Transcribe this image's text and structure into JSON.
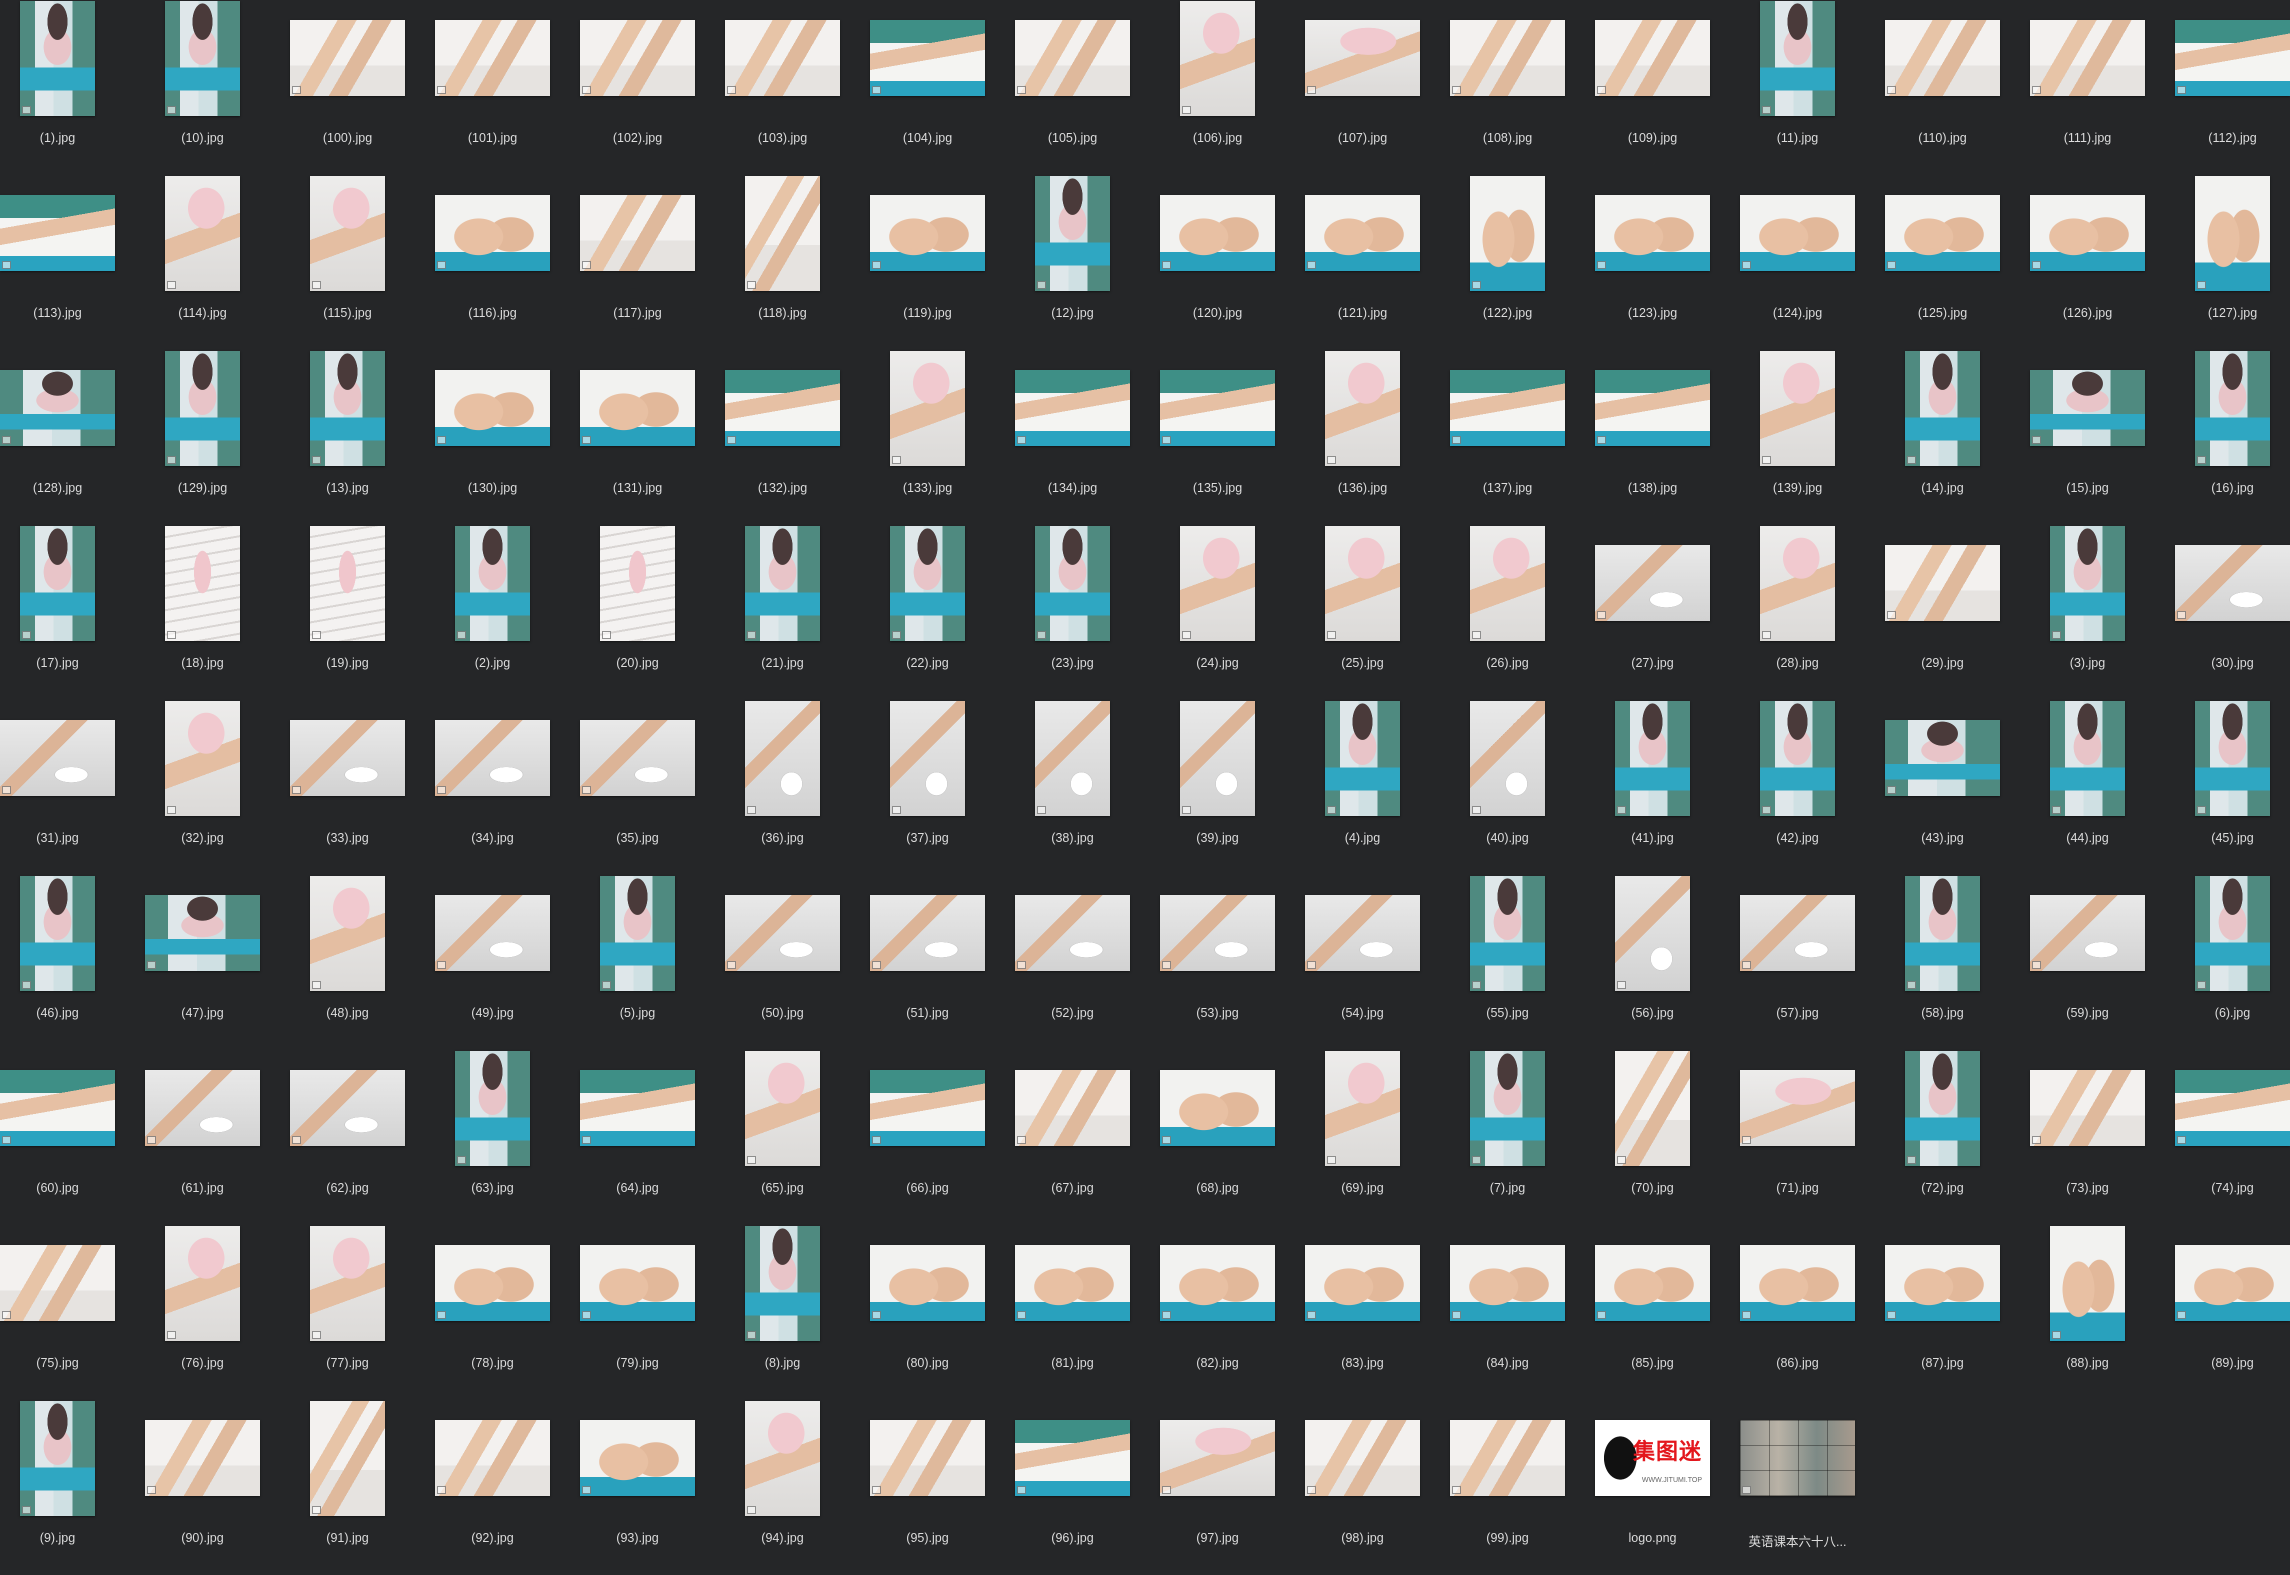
{
  "files": [
    {
      "name": "(1).jpg",
      "kind": "portrait",
      "style": "room"
    },
    {
      "name": "(10).jpg",
      "kind": "portrait",
      "style": "room"
    },
    {
      "name": "(100).jpg",
      "kind": "landscape",
      "style": "legs"
    },
    {
      "name": "(101).jpg",
      "kind": "landscape",
      "style": "legs"
    },
    {
      "name": "(102).jpg",
      "kind": "landscape",
      "style": "legs"
    },
    {
      "name": "(103).jpg",
      "kind": "landscape",
      "style": "legs"
    },
    {
      "name": "(104).jpg",
      "kind": "landscape",
      "style": "sofa"
    },
    {
      "name": "(105).jpg",
      "kind": "landscape",
      "style": "legs"
    },
    {
      "name": "(106).jpg",
      "kind": "portrait",
      "style": "pink"
    },
    {
      "name": "(107).jpg",
      "kind": "landscape",
      "style": "pink"
    },
    {
      "name": "(108).jpg",
      "kind": "landscape",
      "style": "legs"
    },
    {
      "name": "(109).jpg",
      "kind": "landscape",
      "style": "legs"
    },
    {
      "name": "(11).jpg",
      "kind": "portrait",
      "style": "room"
    },
    {
      "name": "(110).jpg",
      "kind": "landscape",
      "style": "legs"
    },
    {
      "name": "(111).jpg",
      "kind": "landscape",
      "style": "legs"
    },
    {
      "name": "(112).jpg",
      "kind": "landscape",
      "style": "sofa"
    },
    {
      "name": "(113).jpg",
      "kind": "landscape",
      "style": "sofa"
    },
    {
      "name": "(114).jpg",
      "kind": "portrait",
      "style": "pink"
    },
    {
      "name": "(115).jpg",
      "kind": "portrait",
      "style": "pink"
    },
    {
      "name": "(116).jpg",
      "kind": "landscape",
      "style": "feet"
    },
    {
      "name": "(117).jpg",
      "kind": "landscape",
      "style": "legs"
    },
    {
      "name": "(118).jpg",
      "kind": "portrait",
      "style": "legs"
    },
    {
      "name": "(119).jpg",
      "kind": "landscape",
      "style": "feet"
    },
    {
      "name": "(12).jpg",
      "kind": "portrait",
      "style": "room"
    },
    {
      "name": "(120).jpg",
      "kind": "landscape",
      "style": "feet"
    },
    {
      "name": "(121).jpg",
      "kind": "landscape",
      "style": "feet"
    },
    {
      "name": "(122).jpg",
      "kind": "portrait",
      "style": "feet"
    },
    {
      "name": "(123).jpg",
      "kind": "landscape",
      "style": "feet"
    },
    {
      "name": "(124).jpg",
      "kind": "landscape",
      "style": "feet"
    },
    {
      "name": "(125).jpg",
      "kind": "landscape",
      "style": "feet"
    },
    {
      "name": "(126).jpg",
      "kind": "landscape",
      "style": "feet"
    },
    {
      "name": "(127).jpg",
      "kind": "portrait",
      "style": "feet"
    },
    {
      "name": "(128).jpg",
      "kind": "landscape",
      "style": "room"
    },
    {
      "name": "(129).jpg",
      "kind": "portrait",
      "style": "room"
    },
    {
      "name": "(13).jpg",
      "kind": "portrait",
      "style": "room"
    },
    {
      "name": "(130).jpg",
      "kind": "landscape",
      "style": "feet"
    },
    {
      "name": "(131).jpg",
      "kind": "landscape",
      "style": "feet"
    },
    {
      "name": "(132).jpg",
      "kind": "landscape",
      "style": "sofa"
    },
    {
      "name": "(133).jpg",
      "kind": "portrait",
      "style": "pink"
    },
    {
      "name": "(134).jpg",
      "kind": "landscape",
      "style": "sofa"
    },
    {
      "name": "(135).jpg",
      "kind": "landscape",
      "style": "sofa"
    },
    {
      "name": "(136).jpg",
      "kind": "portrait",
      "style": "pink"
    },
    {
      "name": "(137).jpg",
      "kind": "landscape",
      "style": "sofa"
    },
    {
      "name": "(138).jpg",
      "kind": "landscape",
      "style": "sofa"
    },
    {
      "name": "(139).jpg",
      "kind": "portrait",
      "style": "pink"
    },
    {
      "name": "(14).jpg",
      "kind": "portrait",
      "style": "room"
    },
    {
      "name": "(15).jpg",
      "kind": "landscape",
      "style": "room"
    },
    {
      "name": "(16).jpg",
      "kind": "portrait",
      "style": "room"
    },
    {
      "name": "(17).jpg",
      "kind": "portrait",
      "style": "room"
    },
    {
      "name": "(18).jpg",
      "kind": "portrait",
      "style": "stairs"
    },
    {
      "name": "(19).jpg",
      "kind": "portrait",
      "style": "stairs"
    },
    {
      "name": "(2).jpg",
      "kind": "portrait",
      "style": "room"
    },
    {
      "name": "(20).jpg",
      "kind": "portrait",
      "style": "stairs"
    },
    {
      "name": "(21).jpg",
      "kind": "portrait",
      "style": "room"
    },
    {
      "name": "(22).jpg",
      "kind": "portrait",
      "style": "room"
    },
    {
      "name": "(23).jpg",
      "kind": "portrait",
      "style": "room"
    },
    {
      "name": "(24).jpg",
      "kind": "portrait",
      "style": "pink"
    },
    {
      "name": "(25).jpg",
      "kind": "portrait",
      "style": "pink"
    },
    {
      "name": "(26).jpg",
      "kind": "portrait",
      "style": "pink"
    },
    {
      "name": "(27).jpg",
      "kind": "landscape",
      "style": "floor"
    },
    {
      "name": "(28).jpg",
      "kind": "portrait",
      "style": "pink"
    },
    {
      "name": "(29).jpg",
      "kind": "landscape",
      "style": "legs"
    },
    {
      "name": "(3).jpg",
      "kind": "portrait",
      "style": "room"
    },
    {
      "name": "(30).jpg",
      "kind": "landscape",
      "style": "floor"
    },
    {
      "name": "(31).jpg",
      "kind": "landscape",
      "style": "floor"
    },
    {
      "name": "(32).jpg",
      "kind": "portrait",
      "style": "pink"
    },
    {
      "name": "(33).jpg",
      "kind": "landscape",
      "style": "floor"
    },
    {
      "name": "(34).jpg",
      "kind": "landscape",
      "style": "floor"
    },
    {
      "name": "(35).jpg",
      "kind": "landscape",
      "style": "floor"
    },
    {
      "name": "(36).jpg",
      "kind": "portrait",
      "style": "floor"
    },
    {
      "name": "(37).jpg",
      "kind": "portrait",
      "style": "floor"
    },
    {
      "name": "(38).jpg",
      "kind": "portrait",
      "style": "floor"
    },
    {
      "name": "(39).jpg",
      "kind": "portrait",
      "style": "floor"
    },
    {
      "name": "(4).jpg",
      "kind": "portrait",
      "style": "room"
    },
    {
      "name": "(40).jpg",
      "kind": "portrait",
      "style": "floor"
    },
    {
      "name": "(41).jpg",
      "kind": "portrait",
      "style": "room"
    },
    {
      "name": "(42).jpg",
      "kind": "portrait",
      "style": "room"
    },
    {
      "name": "(43).jpg",
      "kind": "landscape",
      "style": "room"
    },
    {
      "name": "(44).jpg",
      "kind": "portrait",
      "style": "room"
    },
    {
      "name": "(45).jpg",
      "kind": "portrait",
      "style": "room"
    },
    {
      "name": "(46).jpg",
      "kind": "portrait",
      "style": "room"
    },
    {
      "name": "(47).jpg",
      "kind": "landscape",
      "style": "room"
    },
    {
      "name": "(48).jpg",
      "kind": "portrait",
      "style": "pink"
    },
    {
      "name": "(49).jpg",
      "kind": "landscape",
      "style": "floor"
    },
    {
      "name": "(5).jpg",
      "kind": "portrait",
      "style": "room"
    },
    {
      "name": "(50).jpg",
      "kind": "landscape",
      "style": "floor"
    },
    {
      "name": "(51).jpg",
      "kind": "landscape",
      "style": "floor"
    },
    {
      "name": "(52).jpg",
      "kind": "landscape",
      "style": "floor"
    },
    {
      "name": "(53).jpg",
      "kind": "landscape",
      "style": "floor"
    },
    {
      "name": "(54).jpg",
      "kind": "landscape",
      "style": "floor"
    },
    {
      "name": "(55).jpg",
      "kind": "portrait",
      "style": "room"
    },
    {
      "name": "(56).jpg",
      "kind": "portrait",
      "style": "floor"
    },
    {
      "name": "(57).jpg",
      "kind": "landscape",
      "style": "floor"
    },
    {
      "name": "(58).jpg",
      "kind": "portrait",
      "style": "room"
    },
    {
      "name": "(59).jpg",
      "kind": "landscape",
      "style": "floor"
    },
    {
      "name": "(6).jpg",
      "kind": "portrait",
      "style": "room"
    },
    {
      "name": "(60).jpg",
      "kind": "landscape",
      "style": "sofa"
    },
    {
      "name": "(61).jpg",
      "kind": "landscape",
      "style": "floor"
    },
    {
      "name": "(62).jpg",
      "kind": "landscape",
      "style": "floor"
    },
    {
      "name": "(63).jpg",
      "kind": "portrait",
      "style": "room"
    },
    {
      "name": "(64).jpg",
      "kind": "landscape",
      "style": "sofa"
    },
    {
      "name": "(65).jpg",
      "kind": "portrait",
      "style": "pink"
    },
    {
      "name": "(66).jpg",
      "kind": "landscape",
      "style": "sofa"
    },
    {
      "name": "(67).jpg",
      "kind": "landscape",
      "style": "legs"
    },
    {
      "name": "(68).jpg",
      "kind": "landscape",
      "style": "feet"
    },
    {
      "name": "(69).jpg",
      "kind": "portrait",
      "style": "pink"
    },
    {
      "name": "(7).jpg",
      "kind": "portrait",
      "style": "room"
    },
    {
      "name": "(70).jpg",
      "kind": "portrait",
      "style": "legs"
    },
    {
      "name": "(71).jpg",
      "kind": "landscape",
      "style": "pink"
    },
    {
      "name": "(72).jpg",
      "kind": "portrait",
      "style": "room"
    },
    {
      "name": "(73).jpg",
      "kind": "landscape",
      "style": "legs"
    },
    {
      "name": "(74).jpg",
      "kind": "landscape",
      "style": "sofa"
    },
    {
      "name": "(75).jpg",
      "kind": "landscape",
      "style": "legs"
    },
    {
      "name": "(76).jpg",
      "kind": "portrait",
      "style": "pink"
    },
    {
      "name": "(77).jpg",
      "kind": "portrait",
      "style": "pink"
    },
    {
      "name": "(78).jpg",
      "kind": "landscape",
      "style": "feet"
    },
    {
      "name": "(79).jpg",
      "kind": "landscape",
      "style": "feet"
    },
    {
      "name": "(8).jpg",
      "kind": "portrait",
      "style": "room"
    },
    {
      "name": "(80).jpg",
      "kind": "landscape",
      "style": "feet"
    },
    {
      "name": "(81).jpg",
      "kind": "landscape",
      "style": "feet"
    },
    {
      "name": "(82).jpg",
      "kind": "landscape",
      "style": "feet"
    },
    {
      "name": "(83).jpg",
      "kind": "landscape",
      "style": "feet"
    },
    {
      "name": "(84).jpg",
      "kind": "landscape",
      "style": "feet"
    },
    {
      "name": "(85).jpg",
      "kind": "landscape",
      "style": "feet"
    },
    {
      "name": "(86).jpg",
      "kind": "landscape",
      "style": "feet"
    },
    {
      "name": "(87).jpg",
      "kind": "landscape",
      "style": "feet"
    },
    {
      "name": "(88).jpg",
      "kind": "portrait",
      "style": "feet"
    },
    {
      "name": "(89).jpg",
      "kind": "landscape",
      "style": "feet"
    },
    {
      "name": "(9).jpg",
      "kind": "portrait",
      "style": "room"
    },
    {
      "name": "(90).jpg",
      "kind": "landscape",
      "style": "legs"
    },
    {
      "name": "(91).jpg",
      "kind": "portrait",
      "style": "legs"
    },
    {
      "name": "(92).jpg",
      "kind": "landscape",
      "style": "legs"
    },
    {
      "name": "(93).jpg",
      "kind": "landscape",
      "style": "feet"
    },
    {
      "name": "(94).jpg",
      "kind": "portrait",
      "style": "pink"
    },
    {
      "name": "(95).jpg",
      "kind": "landscape",
      "style": "legs"
    },
    {
      "name": "(96).jpg",
      "kind": "landscape",
      "style": "sofa"
    },
    {
      "name": "(97).jpg",
      "kind": "landscape",
      "style": "pink"
    },
    {
      "name": "(98).jpg",
      "kind": "landscape",
      "style": "legs"
    },
    {
      "name": "(99).jpg",
      "kind": "landscape",
      "style": "legs"
    },
    {
      "name": "logo.png",
      "kind": "logo",
      "style": "logo",
      "logo_text": "集图迷",
      "logo_url": "WWW.JITUMI.TOP"
    },
    {
      "name": "英语课本六十八...",
      "kind": "tile",
      "style": "mosaic"
    }
  ]
}
